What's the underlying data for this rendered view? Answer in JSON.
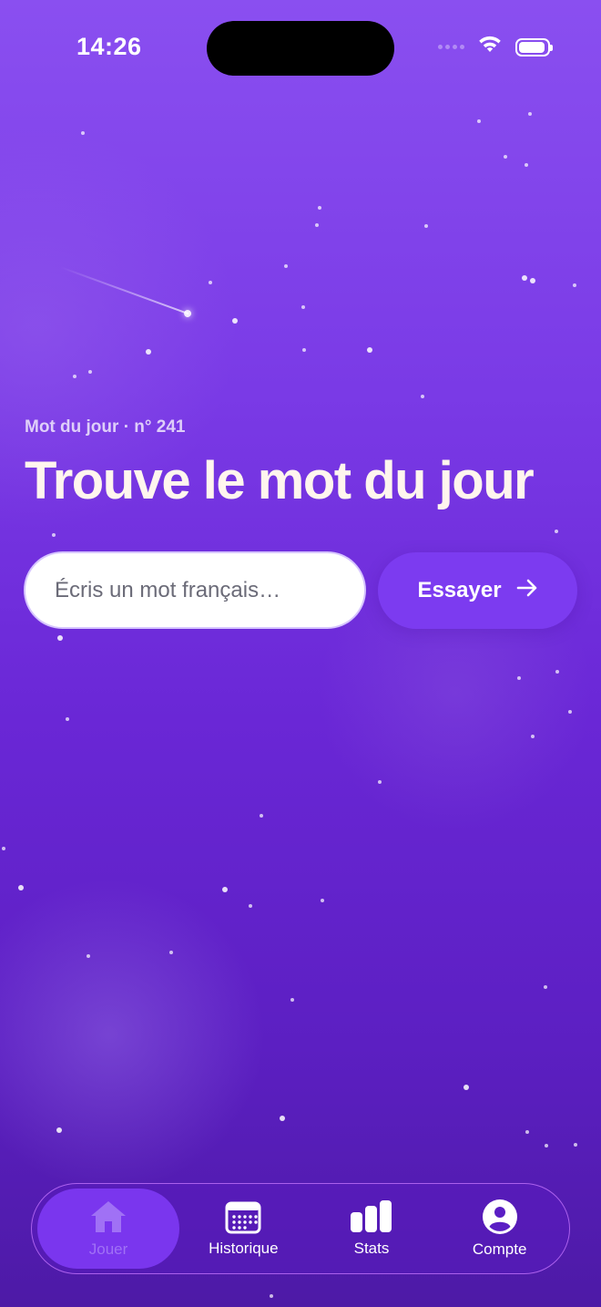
{
  "status_bar": {
    "time": "14:26",
    "icons": [
      "cellular-signal-icon",
      "wifi-icon",
      "battery-icon"
    ]
  },
  "main": {
    "kicker": "Mot du jour · n° 241",
    "title": "Trouve le mot du jour",
    "input": {
      "placeholder": "Écris un mot français…",
      "value": ""
    },
    "submit": {
      "label": "Essayer",
      "icon": "arrow-right-icon"
    }
  },
  "tab_bar": {
    "active": "Jouer",
    "items": [
      {
        "label": "Jouer",
        "icon": "home-icon"
      },
      {
        "label": "Historique",
        "icon": "calendar-icon"
      },
      {
        "label": "Stats",
        "icon": "bar-chart-icon"
      },
      {
        "label": "Compte",
        "icon": "user-icon"
      }
    ]
  },
  "colors": {
    "background_top": "#8a4ff0",
    "background_bottom": "#4d1aa6",
    "accent": "#7c3bf0",
    "active_tab_text": "#a071f5",
    "title_text": "#fff5ee"
  }
}
